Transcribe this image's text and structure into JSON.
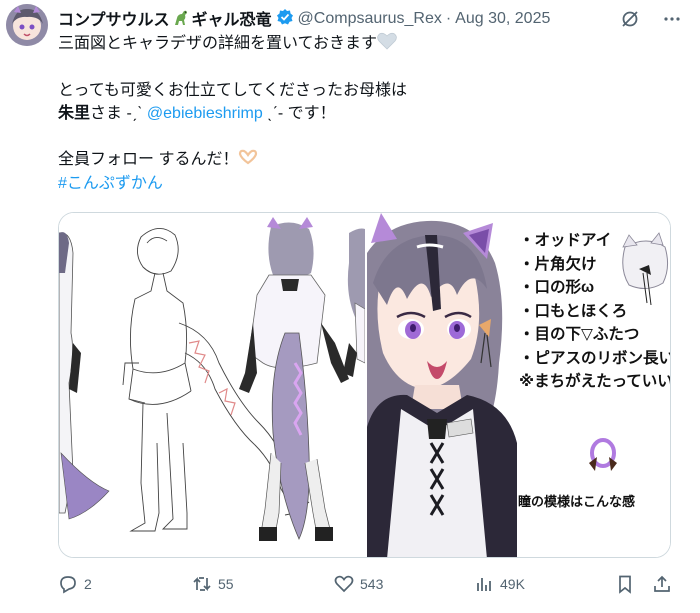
{
  "author": {
    "display_name": "コンプサウルス",
    "display_name_suffix": "ギャル恐竜",
    "handle": "@Compsaurus_Rex",
    "date": "Aug 30, 2025",
    "name_emoji": "dinosaur-icon",
    "verified_icon": "verified-badge-icon",
    "avatar": "avatar"
  },
  "header_icons": [
    "grok-icon",
    "more-icon"
  ],
  "tweet": {
    "line1": "三面図とキャラデザの詳細を置いておきます",
    "line2": "とっても可愛くお仕立てしてくださったお母様は",
    "line3_bold": "朱里",
    "line3_mid": "さま -ˏˋ",
    "line3_mention": "@ebiebieshrimp",
    "line3_end": "ˎˊ- です！",
    "line4": "全員フォロー するんだ！",
    "hashtag": "#こんぷずかん"
  },
  "media": {
    "notes": [
      "・オッドアイ",
      "・片角欠け",
      "・口の形ω",
      "・口もとほくろ",
      "・目の下▽ふたつ",
      "・ピアスのリボン長い",
      "※まちがえたっていい"
    ],
    "pupil_caption": "瞳の模様はこんな感"
  },
  "actions": {
    "replies": "2",
    "reposts": "55",
    "likes": "543",
    "views": "49K"
  },
  "colors": {
    "text": "#0f1419",
    "secondary": "#536471",
    "link": "#1d9bf0",
    "verified": "#1d9bf0",
    "accent_purple": "#9b7bd1"
  }
}
